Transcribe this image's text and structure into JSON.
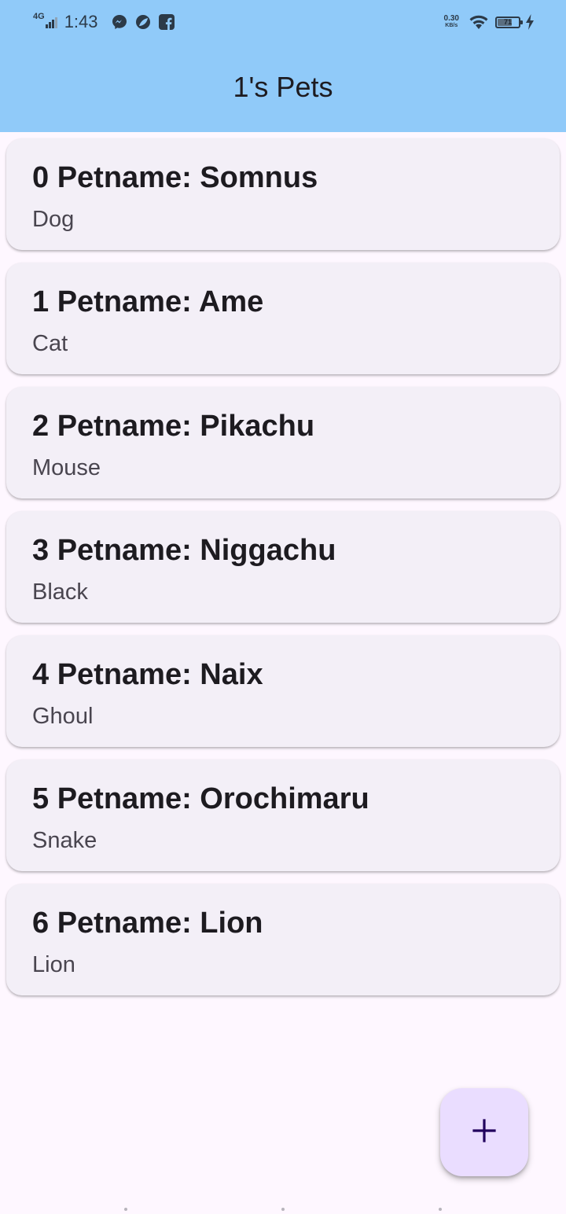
{
  "status_bar": {
    "network_type": "4G",
    "time": "1:43",
    "notification_icons": [
      "messenger-icon",
      "leaf-icon",
      "facebook-icon"
    ],
    "net_speed_value": "0.30",
    "net_speed_unit": "KB/s",
    "battery_level": "71"
  },
  "app_bar": {
    "title": "1's Pets",
    "background": "#90caf9"
  },
  "pets": [
    {
      "title": "0 Petname: Somnus",
      "type": "Dog"
    },
    {
      "title": "1 Petname: Ame",
      "type": "Cat"
    },
    {
      "title": "2 Petname: Pikachu",
      "type": "Mouse"
    },
    {
      "title": "3 Petname: Niggachu",
      "type": "Black"
    },
    {
      "title": "4 Petname: Naix",
      "type": "Ghoul"
    },
    {
      "title": "5 Petname: Orochimaru",
      "type": "Snake"
    },
    {
      "title": "6 Petname: Lion",
      "type": "Lion"
    }
  ],
  "fab": {
    "icon": "plus-icon",
    "background": "#eaddff"
  },
  "colors": {
    "page_background": "#fef7ff",
    "card_background": "#f3eff7",
    "title_text": "#1d1b20",
    "subtitle_text": "#49454f"
  }
}
